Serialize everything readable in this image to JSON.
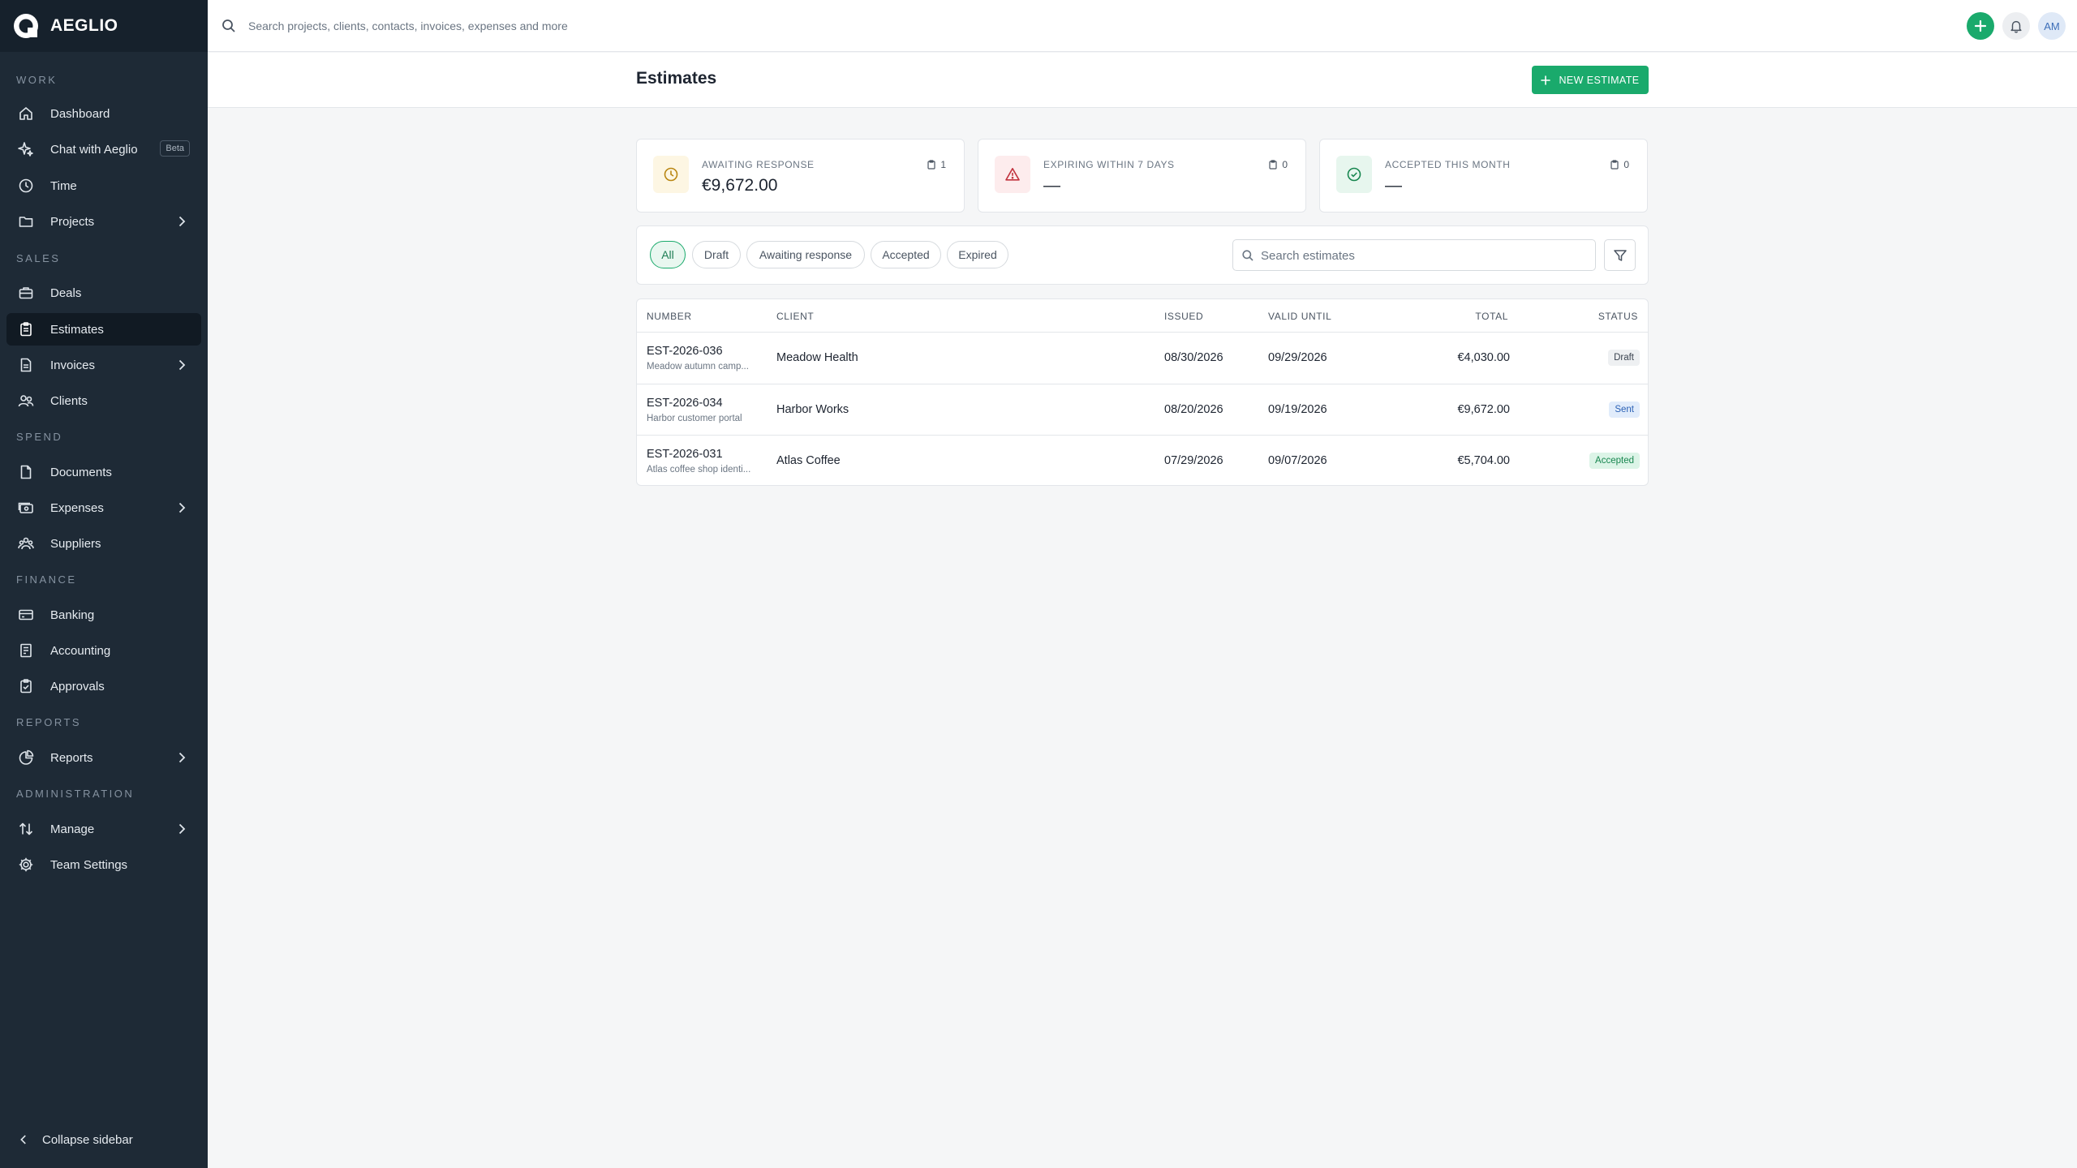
{
  "app": {
    "name": "AEGLIO"
  },
  "sidebar": {
    "sections": {
      "work": "WORK",
      "sales": "SALES",
      "spend": "SPEND",
      "finance": "FINANCE",
      "reports": "REPORTS",
      "administration": "ADMINISTRATION"
    },
    "items": {
      "dashboard": "Dashboard",
      "chat": "Chat with Aeglio",
      "chat_badge": "Beta",
      "time": "Time",
      "projects": "Projects",
      "deals": "Deals",
      "estimates": "Estimates",
      "invoices": "Invoices",
      "clients": "Clients",
      "documents": "Documents",
      "expenses": "Expenses",
      "suppliers": "Suppliers",
      "banking": "Banking",
      "accounting": "Accounting",
      "approvals": "Approvals",
      "reports": "Reports",
      "manage": "Manage",
      "team_settings": "Team Settings"
    },
    "active": "estimates",
    "collapse_label": "Collapse sidebar"
  },
  "topbar": {
    "search_placeholder": "Search projects, clients, contacts, invoices, expenses and more",
    "avatar_initials": "AM"
  },
  "page": {
    "title": "Estimates",
    "new_button_label": "NEW ESTIMATE"
  },
  "stats": [
    {
      "label": "AWAITING RESPONSE",
      "value": "€9,672.00",
      "count": "1",
      "icon": "clock-icon"
    },
    {
      "label": "EXPIRING WITHIN 7 DAYS",
      "value": "—",
      "count": "0",
      "icon": "warning-icon"
    },
    {
      "label": "ACCEPTED THIS MONTH",
      "value": "—",
      "count": "0",
      "icon": "check-circle-icon"
    }
  ],
  "filters": {
    "chips": [
      "All",
      "Draft",
      "Awaiting response",
      "Accepted",
      "Expired"
    ],
    "active": "All",
    "search_placeholder": "Search estimates"
  },
  "table": {
    "columns": [
      "NUMBER",
      "CLIENT",
      "ISSUED",
      "VALID UNTIL",
      "TOTAL",
      "STATUS"
    ],
    "rows": [
      {
        "number": "EST-2026-036",
        "description": "Meadow autumn camp...",
        "client": "Meadow Health",
        "issued": "08/30/2026",
        "valid_until": "09/29/2026",
        "total": "€4,030.00",
        "status": "Draft"
      },
      {
        "number": "EST-2026-034",
        "description": "Harbor customer portal",
        "client": "Harbor Works",
        "issued": "08/20/2026",
        "valid_until": "09/19/2026",
        "total": "€9,672.00",
        "status": "Sent"
      },
      {
        "number": "EST-2026-031",
        "description": "Atlas coffee shop identi...",
        "client": "Atlas Coffee",
        "issued": "07/29/2026",
        "valid_until": "09/07/2026",
        "total": "€5,704.00",
        "status": "Accepted"
      }
    ]
  },
  "colors": {
    "brand_green": "#1aaa6c",
    "sidebar_bg": "#1e2a36",
    "status_draft": "#eef0f2",
    "status_sent": "#e1ecfb",
    "status_accepted": "#dcf4e7"
  }
}
